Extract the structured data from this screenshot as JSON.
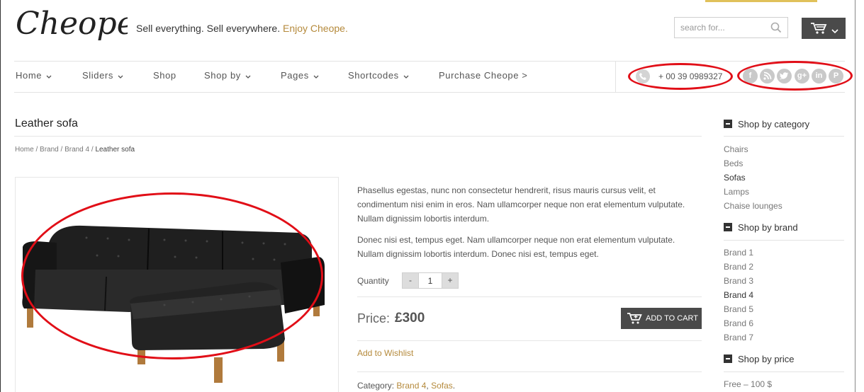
{
  "header": {
    "logo_text": "Cheope",
    "tagline_main": "Sell everything. Sell everywhere.",
    "tagline_accent": "Enjoy Cheope.",
    "search_placeholder": "search for...",
    "accent_color": "#b58a3c"
  },
  "nav": {
    "items": [
      {
        "label": "Home",
        "dropdown": true
      },
      {
        "label": "Sliders",
        "dropdown": true
      },
      {
        "label": "Shop",
        "dropdown": false
      },
      {
        "label": "Shop by",
        "dropdown": true
      },
      {
        "label": "Pages",
        "dropdown": true
      },
      {
        "label": "Shortcodes",
        "dropdown": true
      },
      {
        "label": "Purchase Cheope >",
        "dropdown": false
      }
    ],
    "phone": "+ 00 39 0989327",
    "social": [
      "facebook-icon",
      "rss-icon",
      "twitter-icon",
      "googleplus-icon",
      "linkedin-icon",
      "pinterest-icon"
    ]
  },
  "product": {
    "title": "Leather sofa",
    "breadcrumb": {
      "home": "Home",
      "brand": "Brand",
      "brand4": "Brand 4",
      "current": "Leather sofa",
      "separator": " / "
    },
    "description": [
      "Phasellus egestas, nunc non consectetur hendrerit, risus mauris cursus velit, et condimentum nisi enim in eros. Nam ullamcorper neque non erat elementum vulputate. Nullam dignissim lobortis interdum.",
      "Donec nisi est, tempus eget. Nam ullamcorper neque non erat elementum vulputate. Nullam dignissim lobortis interdum. Donec nisi est, tempus eget."
    ],
    "quantity_label": "Quantity",
    "quantity_value": "1",
    "minus_label": "-",
    "plus_label": "+",
    "price_label": "Price:",
    "price_value": "£300",
    "add_to_cart_label": "ADD TO CART",
    "wishlist_label": "Add to Wishlist",
    "category_label": "Category:",
    "categories": [
      "Brand 4",
      "Sofas"
    ],
    "category_separator": ", ",
    "category_end": "."
  },
  "sidebar": {
    "category_title": "Shop by category",
    "categories": [
      {
        "label": "Chairs",
        "active": false
      },
      {
        "label": "Beds",
        "active": false
      },
      {
        "label": "Sofas",
        "active": true
      },
      {
        "label": "Lamps",
        "active": false
      },
      {
        "label": "Chaise lounges",
        "active": false
      }
    ],
    "brand_title": "Shop by brand",
    "brands": [
      {
        "label": "Brand 1",
        "active": false
      },
      {
        "label": "Brand 2",
        "active": false
      },
      {
        "label": "Brand 3",
        "active": false
      },
      {
        "label": "Brand 4",
        "active": true
      },
      {
        "label": "Brand 5",
        "active": false
      },
      {
        "label": "Brand 6",
        "active": false
      },
      {
        "label": "Brand 7",
        "active": false
      }
    ],
    "price_title": "Shop by price",
    "prices": [
      {
        "label": "Free – 100 $",
        "active": false
      }
    ]
  },
  "colors": {
    "annotation": "#e10e17",
    "dark_button": "#4a4a4a"
  }
}
